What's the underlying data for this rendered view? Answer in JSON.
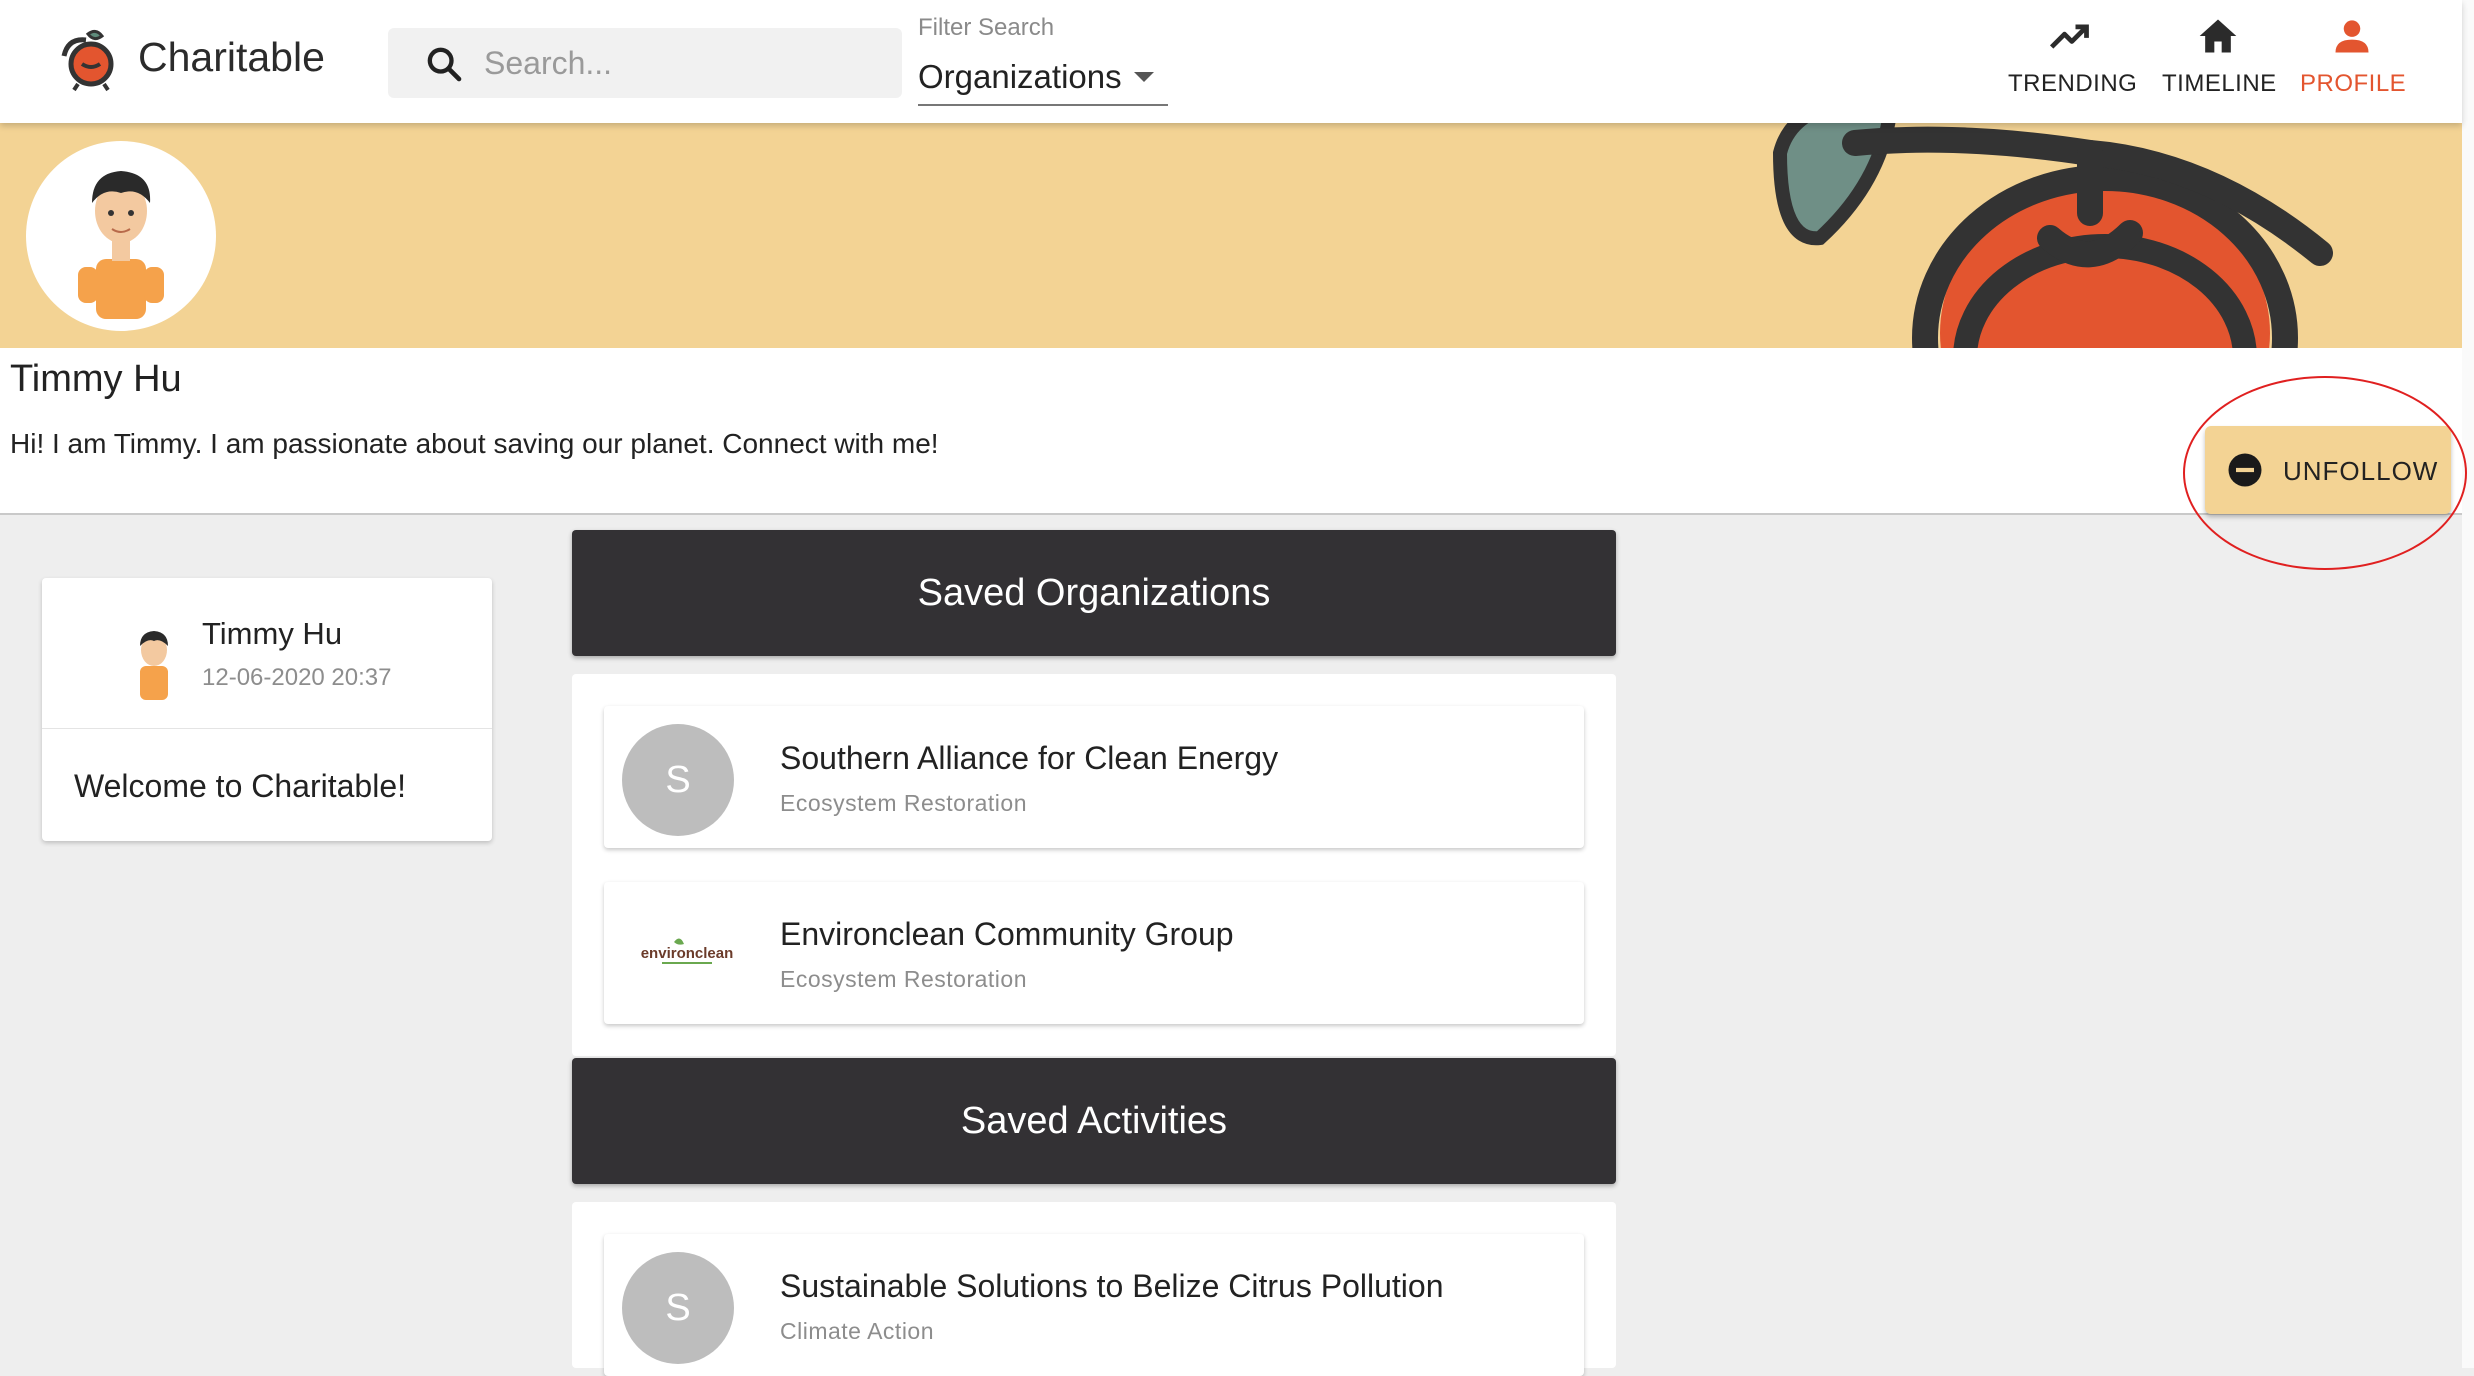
{
  "app": {
    "brand": "Charitable"
  },
  "search": {
    "placeholder": "Search..."
  },
  "filter": {
    "label": "Filter Search",
    "value": "Organizations"
  },
  "nav": [
    {
      "label": "TRENDING",
      "icon": "trending-up-icon"
    },
    {
      "label": "TIMELINE",
      "icon": "home-icon"
    },
    {
      "label": "PROFILE",
      "icon": "person-icon",
      "active": true
    }
  ],
  "colors": {
    "accent": "#e3552f",
    "banner": "#f3d394",
    "section_header": "#333134",
    "annotation": "#e02020"
  },
  "profile": {
    "name": "Timmy Hu",
    "bio": "Hi! I am Timmy. I am passionate about saving our planet. Connect with me!",
    "unfollow_label": "UNFOLLOW"
  },
  "post": {
    "author": "Timmy Hu",
    "date": "12-06-2020 20:37",
    "body": "Welcome to Charitable!"
  },
  "saved_organizations": {
    "title": "Saved Organizations",
    "items": [
      {
        "avatar_letter": "S",
        "name": "Southern Alliance for Clean Energy",
        "category": "Ecosystem Restoration"
      },
      {
        "logo_text": "environclean",
        "name": "Environclean Community Group",
        "category": "Ecosystem Restoration"
      }
    ]
  },
  "saved_activities": {
    "title": "Saved Activities",
    "items": [
      {
        "avatar_letter": "S",
        "name": "Sustainable Solutions to Belize Citrus Pollution",
        "category": "Climate Action"
      }
    ]
  }
}
